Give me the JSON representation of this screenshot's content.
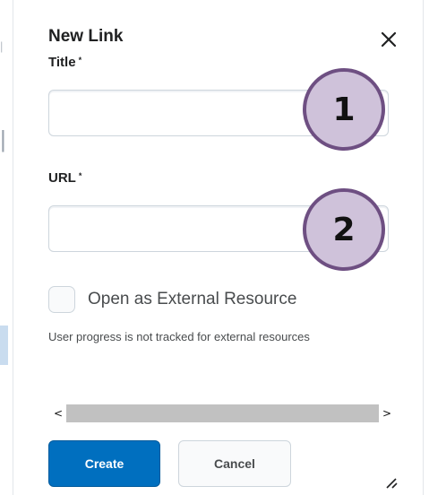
{
  "dialog": {
    "title": "New Link",
    "close_icon": "close-icon",
    "resize_icon": "resize-grip-icon"
  },
  "form": {
    "title_field": {
      "label": "Title",
      "required_mark": "*",
      "value": "",
      "marker": "1"
    },
    "url_field": {
      "label": "URL",
      "required_mark": "*",
      "value": "",
      "marker": "2"
    },
    "external_checkbox": {
      "label": "Open as External Resource",
      "checked": false
    },
    "help_text": "User progress is not tracked for external resources"
  },
  "scrollbar": {
    "left_arrow": "<",
    "right_arrow": ">"
  },
  "buttons": {
    "create": "Create",
    "cancel": "Cancel"
  },
  "colors": {
    "primary": "#006fbf",
    "marker_fill": "#cfc2da",
    "marker_border": "#6e4f82"
  }
}
